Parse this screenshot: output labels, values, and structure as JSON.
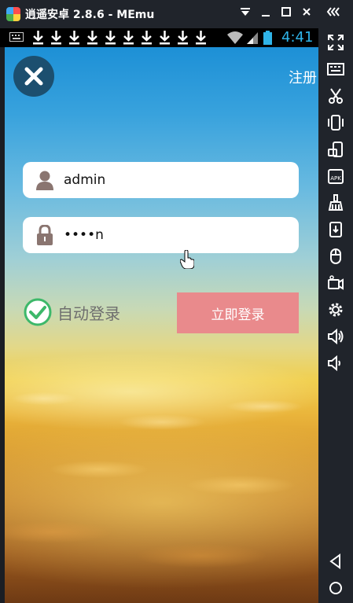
{
  "window": {
    "title": "逍遥安卓 2.8.6 - MEmu",
    "controls": {
      "menu_icon": "dropdown-menu-icon",
      "minimize_icon": "minimize-icon",
      "maximize_icon": "maximize-icon",
      "close_icon": "close-icon",
      "collapse_icon": "collapse-sidebar-icon"
    }
  },
  "status_bar": {
    "time": "4:41",
    "download_notification_count": 10,
    "icons": [
      "keyboard-icon",
      "download-icon",
      "wifi-icon",
      "signal-icon",
      "battery-icon"
    ],
    "time_color": "#2fb4e9"
  },
  "login_screen": {
    "close_icon": "close-icon",
    "register_label": "注册",
    "username": {
      "icon": "user-icon",
      "value": "admin"
    },
    "password": {
      "icon": "lock-icon",
      "value": "••••n"
    },
    "auto_login": {
      "label": "自动登录",
      "checked": true,
      "check_color": "#3db86a"
    },
    "login_button": {
      "label": "立即登录",
      "color": "#e98a8c"
    }
  },
  "toolbar": {
    "items": [
      {
        "icon": "fullscreen-icon"
      },
      {
        "icon": "keyboard-mapping-icon"
      },
      {
        "icon": "screenshot-scissors-icon"
      },
      {
        "icon": "shake-icon"
      },
      {
        "icon": "rotate-screen-icon"
      },
      {
        "icon": "apk-install-icon"
      },
      {
        "icon": "clean-broom-icon"
      },
      {
        "icon": "file-share-icon"
      },
      {
        "icon": "mouse-icon"
      },
      {
        "icon": "video-record-icon"
      },
      {
        "icon": "settings-gear-icon"
      },
      {
        "icon": "volume-up-icon"
      },
      {
        "icon": "volume-down-icon"
      }
    ],
    "nav": [
      {
        "icon": "back-triangle-icon"
      },
      {
        "icon": "home-circle-icon"
      }
    ]
  }
}
